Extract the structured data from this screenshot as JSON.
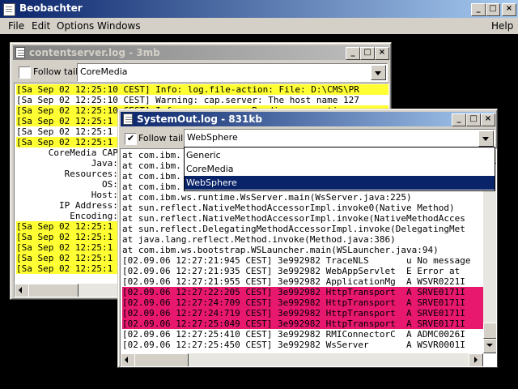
{
  "app": {
    "title": "Beobachter",
    "menu": [
      "File",
      "Edit",
      "Options",
      "Windows"
    ],
    "menu_right": "Help",
    "controls": {
      "minimize": "_",
      "maximize": "□",
      "close": "×"
    }
  },
  "win1": {
    "title": "contentserver.log - 3mb",
    "follow_tail_label": "Follow tail",
    "follow_tail_checked": false,
    "combo_value": "CoreMedia",
    "lines": [
      {
        "text": "[Sa Sep 02 12:25:10 CEST] Info: log.file-action: File: D:\\CMS\\PR",
        "bg": "#ffff33"
      },
      {
        "text": "[Sa Sep 02 12:25:10 CEST] Warning: cap.server: The host name 127",
        "bg": "#ffffff"
      },
      {
        "text": "[Sa Sep 02 12:25:10 CEST] Info: cap.server: Reading properties",
        "bg": "#ffff33"
      },
      {
        "text": "[Sa Sep 02 12:25:1",
        "bg": "#ffff33"
      },
      {
        "text": "[Sa Sep 02 12:25:1",
        "bg": "#ffffff"
      },
      {
        "text": "[Sa Sep 02 12:25:1",
        "bg": "#ffff33"
      },
      {
        "text": "      CoreMedia CAP:",
        "bg": "#ffffff"
      },
      {
        "text": "              Java:",
        "bg": "#ffffff"
      },
      {
        "text": "         Resources:",
        "bg": "#ffffff"
      },
      {
        "text": "                OS:",
        "bg": "#ffffff"
      },
      {
        "text": "              Host:",
        "bg": "#ffffff"
      },
      {
        "text": "        IP Address:",
        "bg": "#ffffff"
      },
      {
        "text": "          Encoding:",
        "bg": "#ffffff"
      },
      {
        "text": "[Sa Sep 02 12:25:1",
        "bg": "#ffff33"
      },
      {
        "text": "[Sa Sep 02 12:25:1",
        "bg": "#ffff33"
      },
      {
        "text": "[Sa Sep 02 12:25:1",
        "bg": "#ffff33"
      },
      {
        "text": "[Sa Sep 02 12:25:1",
        "bg": "#ffff33"
      },
      {
        "text": "[Sa Sep 02 12:25:1",
        "bg": "#ffff33"
      }
    ]
  },
  "win2": {
    "title": "SystemOut.log - 831kb",
    "follow_tail_label": "Follow tail",
    "follow_tail_checked": true,
    "check_mark": "✔",
    "combo_value": "WebSphere",
    "dropdown_options": [
      "Generic",
      "CoreMedia",
      "WebSphere"
    ],
    "dropdown_selected": 2,
    "lines": [
      {
        "text": "at com.ibm.",
        "bg": "#ffffff"
      },
      {
        "text": "at com.ibm.",
        "bg": "#ffffff"
      },
      {
        "text": "at com.ibm.",
        "bg": "#ffffff"
      },
      {
        "text": "at com.ibm.",
        "bg": "#ffffff"
      },
      {
        "text": "at com.ibm.ws.runtime.WsServer.main(WsServer.java:225)",
        "bg": "#ffffff"
      },
      {
        "text": "at sun.reflect.NativeMethodAccessorImpl.invoke0(Native Method)",
        "bg": "#ffffff"
      },
      {
        "text": "at sun.reflect.NativeMethodAccessorImpl.invoke(NativeMethodAcces",
        "bg": "#ffffff"
      },
      {
        "text": "at sun.reflect.DelegatingMethodAccessorImpl.invoke(DelegatingMet",
        "bg": "#ffffff"
      },
      {
        "text": "at java.lang.reflect.Method.invoke(Method.java:386)",
        "bg": "#ffffff"
      },
      {
        "text": "at com.ibm.ws.bootstrap.WSLauncher.main(WSLauncher.java:94)",
        "bg": "#ffffff"
      },
      {
        "text": "[02.09.06 12:27:21:945 CEST] 3e992982 TraceNLS       u No message",
        "bg": "#ffffff"
      },
      {
        "text": "[02.09.06 12:27:21:935 CEST] 3e992982 WebAppServlet  E Error at",
        "bg": "#ffffff"
      },
      {
        "text": "[02.09.06 12:27:21:955 CEST] 3e992982 ApplicationMg  A WSVR0221I",
        "bg": "#ffffff"
      },
      {
        "text": "[02.09.06 12:27:22:205 CEST] 3e992982 HttpTransport  A SRVE0171I",
        "bg": "#e8186e"
      },
      {
        "text": "[02.09.06 12:27:24:709 CEST] 3e992982 HttpTransport  A SRVE0171I",
        "bg": "#e8186e"
      },
      {
        "text": "[02.09.06 12:27:24:719 CEST] 3e992982 HttpTransport  A SRVE0171I",
        "bg": "#e8186e"
      },
      {
        "text": "[02.09.06 12:27:25:049 CEST] 3e992982 HttpTransport  A SRVE0171I",
        "bg": "#e8186e"
      },
      {
        "text": "[02.09.06 12:27:25:410 CEST] 3e992982 RMIConnectorC  A ADMC0026I",
        "bg": "#ffffff"
      },
      {
        "text": "[02.09.06 12:27:25:450 CEST] 3e992982 WsServer       A WSVR0001I",
        "bg": "#ffffff"
      }
    ]
  },
  "colors": {
    "highlight_yellow": "#ffff33",
    "highlight_pink": "#e8186e",
    "titlebar_active": "#0a246a"
  }
}
